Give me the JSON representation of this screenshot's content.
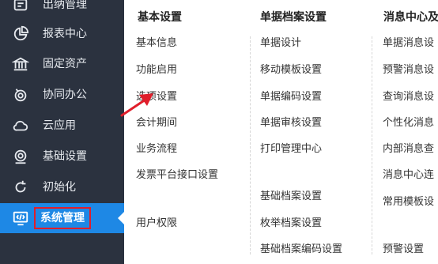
{
  "sidebar": {
    "items": [
      {
        "label": "出纳管理",
        "icon": "cashier-icon"
      },
      {
        "label": "报表中心",
        "icon": "pie-chart-icon"
      },
      {
        "label": "固定资产",
        "icon": "bank-icon"
      },
      {
        "label": "协同办公",
        "icon": "collaboration-icon"
      },
      {
        "label": "云应用",
        "icon": "cloud-icon"
      },
      {
        "label": "基础设置",
        "icon": "settings-icon"
      },
      {
        "label": "初始化",
        "icon": "refresh-icon"
      },
      {
        "label": "系统管理",
        "icon": "code-monitor-icon",
        "active": true
      }
    ]
  },
  "menu": {
    "columns": [
      {
        "title": "基本设置",
        "links": [
          "基本信息",
          "功能启用",
          "选项设置",
          "会计期间",
          "业务流程",
          "发票平台接口设置",
          "用户权限"
        ]
      },
      {
        "title": "单据档案设置",
        "links": [
          "单据设计",
          "移动模板设置",
          "单据编码设置",
          "单据审核设置",
          "打印管理中心",
          "基础档案设置",
          "枚举档案设置",
          "基础档案编码设置"
        ]
      },
      {
        "title": "消息中心及",
        "links": [
          "单据消息设",
          "预警消息设",
          "查询消息设",
          "个性化消息",
          "内部消息查",
          "消息中心连",
          "常用模板设",
          "预警设置"
        ]
      }
    ]
  },
  "colors": {
    "sidebar_bg": "#2b323f",
    "active_bg": "#1e88e5",
    "highlight_border": "#e01e2b",
    "annotation_arrow": "#e01e2b"
  }
}
